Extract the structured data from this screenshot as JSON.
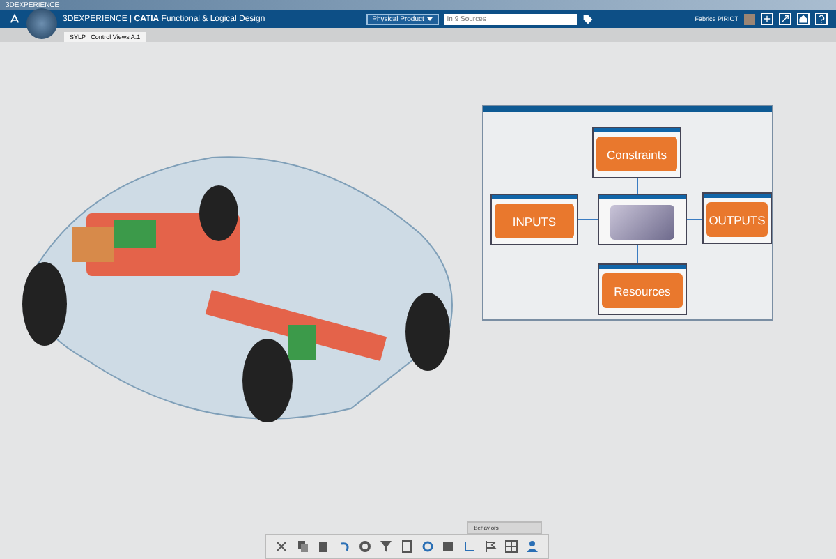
{
  "window": {
    "title": "3DEXPERIENCE"
  },
  "header": {
    "app_title": "3DEXPERIENCE | **CATIA** Functional & Logical Design",
    "scope": "Physical Product",
    "search": {
      "placeholder": "In 9 Sources"
    },
    "user": "Fabrice PIRIOT"
  },
  "tabs": [
    {
      "label": "SYLP : Control Views A.1",
      "selected": true
    }
  ],
  "diagram": {
    "nodes": [
      {
        "label": "Constraints",
        "kind": "block"
      },
      {
        "label": "INPUTS",
        "kind": "block"
      },
      {
        "kind": "image"
      },
      {
        "label": "OUTPUTS",
        "kind": "block"
      },
      {
        "label": "Resources",
        "kind": "block"
      }
    ]
  },
  "toolbar": {
    "section": "Behaviors"
  }
}
